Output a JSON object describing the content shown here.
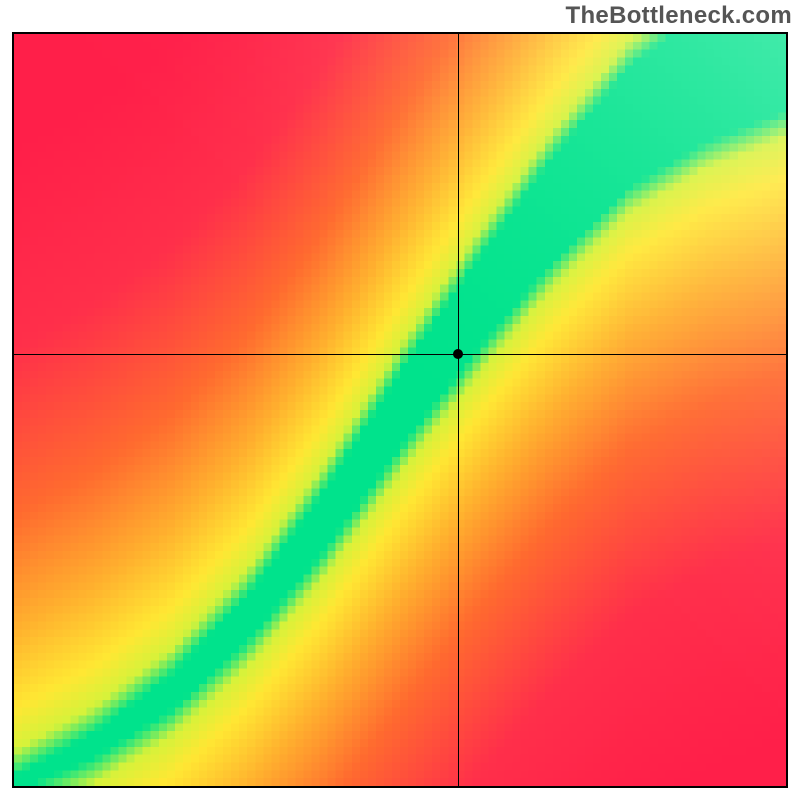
{
  "watermark": "TheBottleneck.com",
  "chart_data": {
    "type": "heatmap",
    "title": "",
    "xlabel": "",
    "ylabel": "",
    "xlim": [
      0,
      1
    ],
    "ylim": [
      0,
      1
    ],
    "grid_resolution": 96,
    "crosshair": {
      "x": 0.575,
      "y": 0.575
    },
    "marker": {
      "x": 0.575,
      "y": 0.575
    },
    "ridge_points": [
      [
        0.0,
        0.0
      ],
      [
        0.1,
        0.05
      ],
      [
        0.2,
        0.12
      ],
      [
        0.3,
        0.22
      ],
      [
        0.4,
        0.35
      ],
      [
        0.5,
        0.5
      ],
      [
        0.6,
        0.64
      ],
      [
        0.7,
        0.77
      ],
      [
        0.8,
        0.88
      ],
      [
        0.9,
        0.95
      ],
      [
        1.0,
        1.0
      ]
    ],
    "ridge_width_points": [
      [
        0.0,
        0.01
      ],
      [
        0.15,
        0.02
      ],
      [
        0.3,
        0.03
      ],
      [
        0.45,
        0.045
      ],
      [
        0.6,
        0.06
      ],
      [
        0.75,
        0.075
      ],
      [
        0.9,
        0.09
      ],
      [
        1.0,
        0.1
      ]
    ],
    "distance_color_stops": [
      {
        "d": 0.0,
        "color": "#00e38c"
      },
      {
        "d": 0.06,
        "color": "#00e38c"
      },
      {
        "d": 0.1,
        "color": "#d6f23a"
      },
      {
        "d": 0.16,
        "color": "#ffe733"
      },
      {
        "d": 0.28,
        "color": "#ffb02e"
      },
      {
        "d": 0.45,
        "color": "#ff6a2f"
      },
      {
        "d": 0.7,
        "color": "#ff2f4a"
      },
      {
        "d": 1.0,
        "color": "#ff1f49"
      }
    ],
    "corner_shade": {
      "corner": "top-right",
      "max_lighten": 0.25
    }
  }
}
